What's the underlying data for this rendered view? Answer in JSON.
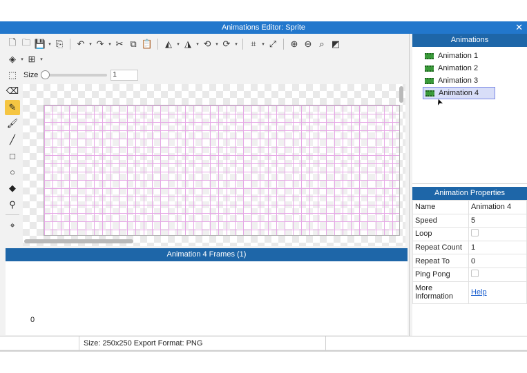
{
  "window": {
    "title": "Animations Editor: Sprite",
    "close_glyph": "✕"
  },
  "toolbar": {
    "row1": [
      {
        "name": "new-file-icon",
        "glyph": "🗋",
        "caret": false
      },
      {
        "name": "open-folder-icon",
        "glyph": "🗀",
        "caret": false
      },
      {
        "name": "save-icon",
        "glyph": "💾",
        "caret": true
      },
      {
        "name": "export-icon",
        "glyph": "⎘",
        "caret": false
      },
      {
        "sep": true
      },
      {
        "name": "undo-icon",
        "glyph": "↶",
        "caret": true
      },
      {
        "name": "redo-icon",
        "glyph": "↷",
        "caret": true
      },
      {
        "name": "cut-icon",
        "glyph": "✂",
        "caret": false
      },
      {
        "name": "copy-icon",
        "glyph": "⧉",
        "caret": false
      },
      {
        "name": "paste-icon",
        "glyph": "📋",
        "caret": false
      },
      {
        "sep": true
      },
      {
        "name": "flip-horizontal-icon",
        "glyph": "◭",
        "caret": true
      },
      {
        "name": "flip-vertical-icon",
        "glyph": "◮",
        "caret": true
      },
      {
        "name": "rotate-left-icon",
        "glyph": "⟲",
        "caret": true
      },
      {
        "name": "rotate-right-icon",
        "glyph": "⟳",
        "caret": true
      },
      {
        "sep": true
      },
      {
        "name": "crop-icon",
        "glyph": "⌗",
        "caret": true
      },
      {
        "name": "resize-icon",
        "glyph": "⤢",
        "caret": false
      },
      {
        "sep": true
      },
      {
        "name": "zoom-in-icon",
        "glyph": "⊕",
        "caret": false
      },
      {
        "name": "zoom-out-icon",
        "glyph": "⊖",
        "caret": false
      },
      {
        "name": "zoom-reset-icon",
        "glyph": "⌕",
        "caret": false
      },
      {
        "name": "fit-to-window-icon",
        "glyph": "◩",
        "caret": false
      }
    ],
    "row2": [
      {
        "name": "layers-icon",
        "glyph": "◈",
        "caret": true
      },
      {
        "name": "grid-icon",
        "glyph": "⊞",
        "caret": true
      }
    ]
  },
  "brush": {
    "label": "Size",
    "value": "1",
    "level": 0,
    "selection_icon": "dashed-selection-icon"
  },
  "tools": [
    {
      "name": "eraser-tool-icon",
      "glyph": "⌫",
      "active": false
    },
    {
      "name": "pencil-tool-icon",
      "glyph": "✎",
      "active": true
    },
    {
      "name": "brush-tool-icon",
      "glyph": "🖌",
      "active": false
    },
    {
      "name": "line-tool-icon",
      "glyph": "╱",
      "active": false
    },
    {
      "name": "rectangle-tool-icon",
      "glyph": "□",
      "active": false
    },
    {
      "name": "ellipse-tool-icon",
      "glyph": "○",
      "active": false
    },
    {
      "name": "fill-bucket-tool-icon",
      "glyph": "◆",
      "active": false
    },
    {
      "name": "eyedropper-tool-icon",
      "glyph": "⚲",
      "active": false
    },
    {
      "divider": true
    },
    {
      "name": "hotspot-tool-icon",
      "glyph": "⌖",
      "active": false
    }
  ],
  "frames": {
    "header": "Animation 4 Frames (1)",
    "frame_label": "0"
  },
  "animations": {
    "header": "Animations",
    "items": [
      "Animation 1",
      "Animation 2",
      "Animation 3",
      "Animation 4"
    ],
    "selected": "Animation 4"
  },
  "properties": {
    "header": "Animation Properties",
    "rows": [
      {
        "key": "Name",
        "value": "Animation 4",
        "type": "text"
      },
      {
        "key": "Speed",
        "value": "5",
        "type": "text"
      },
      {
        "key": "Loop",
        "value": false,
        "type": "checkbox"
      },
      {
        "key": "Repeat Count",
        "value": "1",
        "type": "text"
      },
      {
        "key": "Repeat To",
        "value": "0",
        "type": "text"
      },
      {
        "key": "Ping Pong",
        "value": false,
        "type": "checkbox"
      },
      {
        "key": "More Information",
        "value": "Help",
        "type": "link"
      }
    ]
  },
  "status": {
    "info": "Size: 250x250   Export Format: PNG"
  },
  "colors": {
    "header_blue": "#1e66a8",
    "title_blue": "#2277cc",
    "active_tool": "#f5c542",
    "grid_line": "#e6a8e6"
  }
}
